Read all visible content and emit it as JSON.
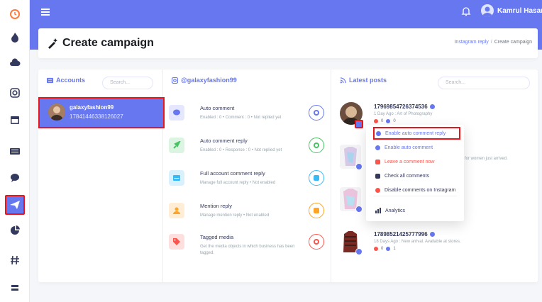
{
  "topbar": {
    "user_name": "Kamrul Hasan"
  },
  "header": {
    "title": "Create campaign",
    "breadcrumb": [
      "Instagram reply",
      "Create campaign"
    ]
  },
  "accounts": {
    "heading": "Accounts",
    "search_placeholder": "Search...",
    "items": [
      {
        "name": "galaxyfashion99",
        "id": "17841446338126027"
      }
    ]
  },
  "actions": {
    "heading": "@galaxyfashion99",
    "items": [
      {
        "title": "Auto comment",
        "desc": "Enabled : 0 • Comment : 0 • Not replied yet",
        "icon": "chat-icon",
        "color": "#6777ef"
      },
      {
        "title": "Auto comment reply",
        "desc": "Enabled : 0 • Response : 0 • Not replied yet",
        "icon": "rocket-icon",
        "color": "#47c363"
      },
      {
        "title": "Full account comment reply",
        "desc": "Manage full account reply • Not enabled",
        "icon": "card-icon",
        "color": "#3abaf4"
      },
      {
        "title": "Mention reply",
        "desc": "Manage mention reply • Not enabled",
        "icon": "users-icon",
        "color": "#ffa426"
      },
      {
        "title": "Tagged media",
        "desc": "Get the media objects in which business has been tagged.",
        "icon": "tags-icon",
        "color": "#fc544b"
      }
    ]
  },
  "posts": {
    "heading": "Latest posts",
    "search_placeholder": "Search...",
    "items": [
      {
        "id": "17969854726374536",
        "meta": "1 Day Ago : Art of Photography",
        "likes": "0",
        "comments": "0"
      },
      {
        "id": "",
        "meta": "for women just arrived.",
        "likes": "",
        "comments": ""
      },
      {
        "id": "",
        "meta": "",
        "likes": "",
        "comments": ""
      },
      {
        "id": "17898521425777996",
        "meta": "18 Days Ago : New arrival. Available at stores.",
        "likes": "0",
        "comments": "1"
      }
    ]
  },
  "dropdown": {
    "items": [
      {
        "label": "Enable auto comment reply",
        "color": "#6777ef"
      },
      {
        "label": "Enable auto comment",
        "color": "#6777ef"
      },
      {
        "label": "Leave a comment now",
        "color": "#fc544b"
      },
      {
        "label": "Check all comments",
        "color": "#34395e"
      },
      {
        "label": "Disable comments on Instagram",
        "color": "#fc544b"
      },
      {
        "label": "Analytics",
        "color": "#34395e"
      }
    ]
  },
  "colors": {
    "primary": "#6777ef",
    "highlight": "#e8151a"
  }
}
